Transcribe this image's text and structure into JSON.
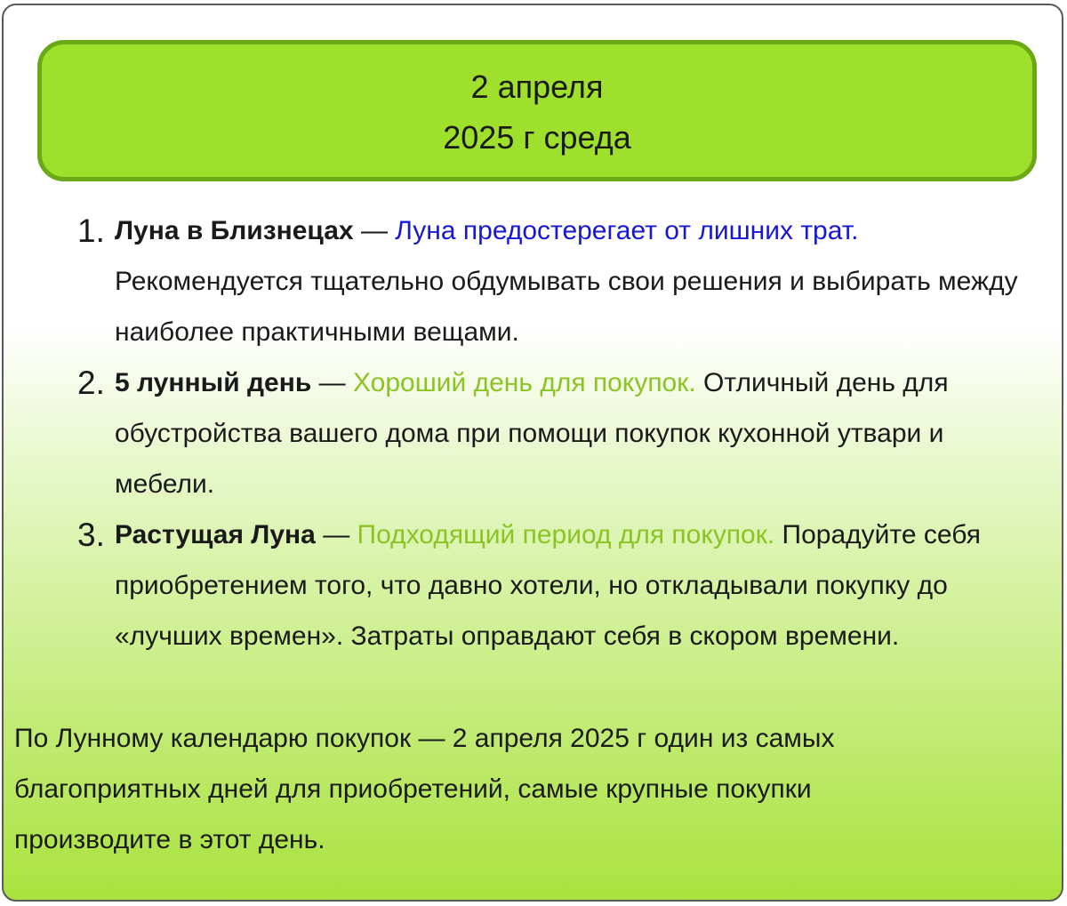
{
  "header": {
    "line1": "2 апреля",
    "line2": "2025 г среда"
  },
  "items": [
    {
      "number": "1.",
      "term": "Луна в Близнецах",
      "dash": " — ",
      "highlight": "Луна предостерегает от лишних трат.",
      "highlight_color": "#1717d6",
      "text": " Рекомендуется тщательно обдумывать свои решения и выбирать между наиболее практичными вещами."
    },
    {
      "number": "2.",
      "term": "5 лунный день",
      "dash": " — ",
      "highlight": "Хороший день для покупок.",
      "highlight_color": "#8bc422",
      "text": " Отличный день для обустройства вашего дома при помощи покупок кухонной утвари и мебели."
    },
    {
      "number": "3.",
      "term": "Растущая Луна",
      "dash": " — ",
      "highlight": "Подходящий период для покупок.",
      "highlight_color": "#8bc422",
      "text": " Порадуйте себя приобретением того, что давно хотели, но откладывали покупку до «лучших времен». Затраты оправдают себя в скором времени."
    }
  ],
  "summary": "По Лунному календарю покупок — 2 апреля 2025 г один из самых благоприятных дней для приобретений, самые крупные покупки производите в этот день.",
  "colors": {
    "header_fill": "#9ee02b",
    "header_border": "#6aa815",
    "gradient_bottom": "#a9e23d"
  }
}
